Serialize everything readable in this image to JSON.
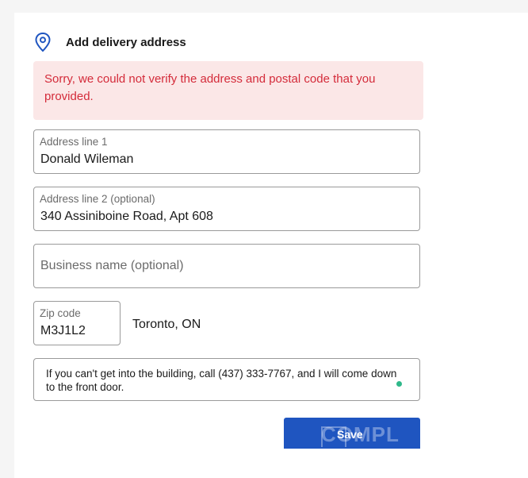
{
  "header": {
    "title": "Add delivery address",
    "icon": "location-pin-icon"
  },
  "error": {
    "message": "Sorry, we could not verify the address and postal code that you provided."
  },
  "form": {
    "address_line_1": {
      "label": "Address line 1",
      "value": "Donald Wileman"
    },
    "address_line_2": {
      "label": "Address line 2 (optional)",
      "value": "340 Assiniboine Road, Apt 608"
    },
    "business_name": {
      "placeholder": "Business name (optional)"
    },
    "zip_code": {
      "label": "Zip code",
      "value": "M3J1L2"
    },
    "city": "Toronto, ON",
    "delivery_note": "If you can't get into the building, call (437) 333-7767, and I will come down to the front door."
  },
  "actions": {
    "save_label": "Save"
  },
  "watermark": "COMPL",
  "colors": {
    "accent": "#1f55c0",
    "error_text": "#d42b3a",
    "error_bg": "#fbe7e7",
    "icon_blue": "#1f55c0",
    "status_dot": "#2fb88a"
  }
}
